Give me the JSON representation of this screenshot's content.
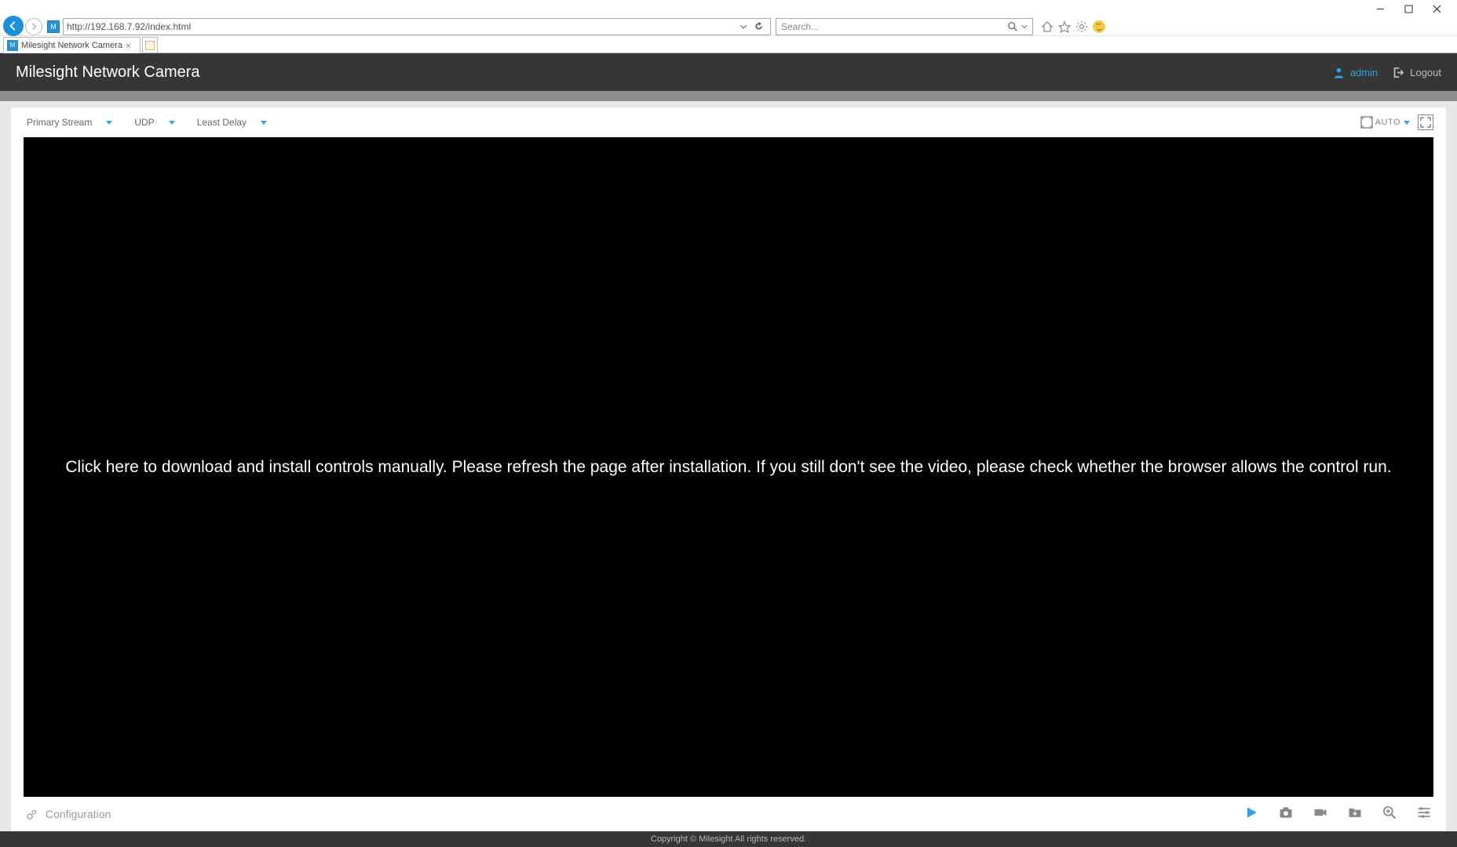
{
  "browser": {
    "url": "http://192.168.7.92/index.html",
    "search_placeholder": "Search...",
    "tab_title": "Milesight Network Camera"
  },
  "header": {
    "title": "Milesight Network Camera",
    "user": "admin",
    "logout": "Logout"
  },
  "dropdowns": {
    "stream": "Primary Stream",
    "protocol": "UDP",
    "delay": "Least Delay",
    "scale": "AUTO"
  },
  "video": {
    "message": "Click here to download and install controls manually. Please refresh the page after installation. If you still don't see the video, please check whether the browser allows the control run."
  },
  "bottom": {
    "configuration": "Configuration"
  },
  "footer": {
    "text": "Copyright © Milesight All rights reserved."
  }
}
